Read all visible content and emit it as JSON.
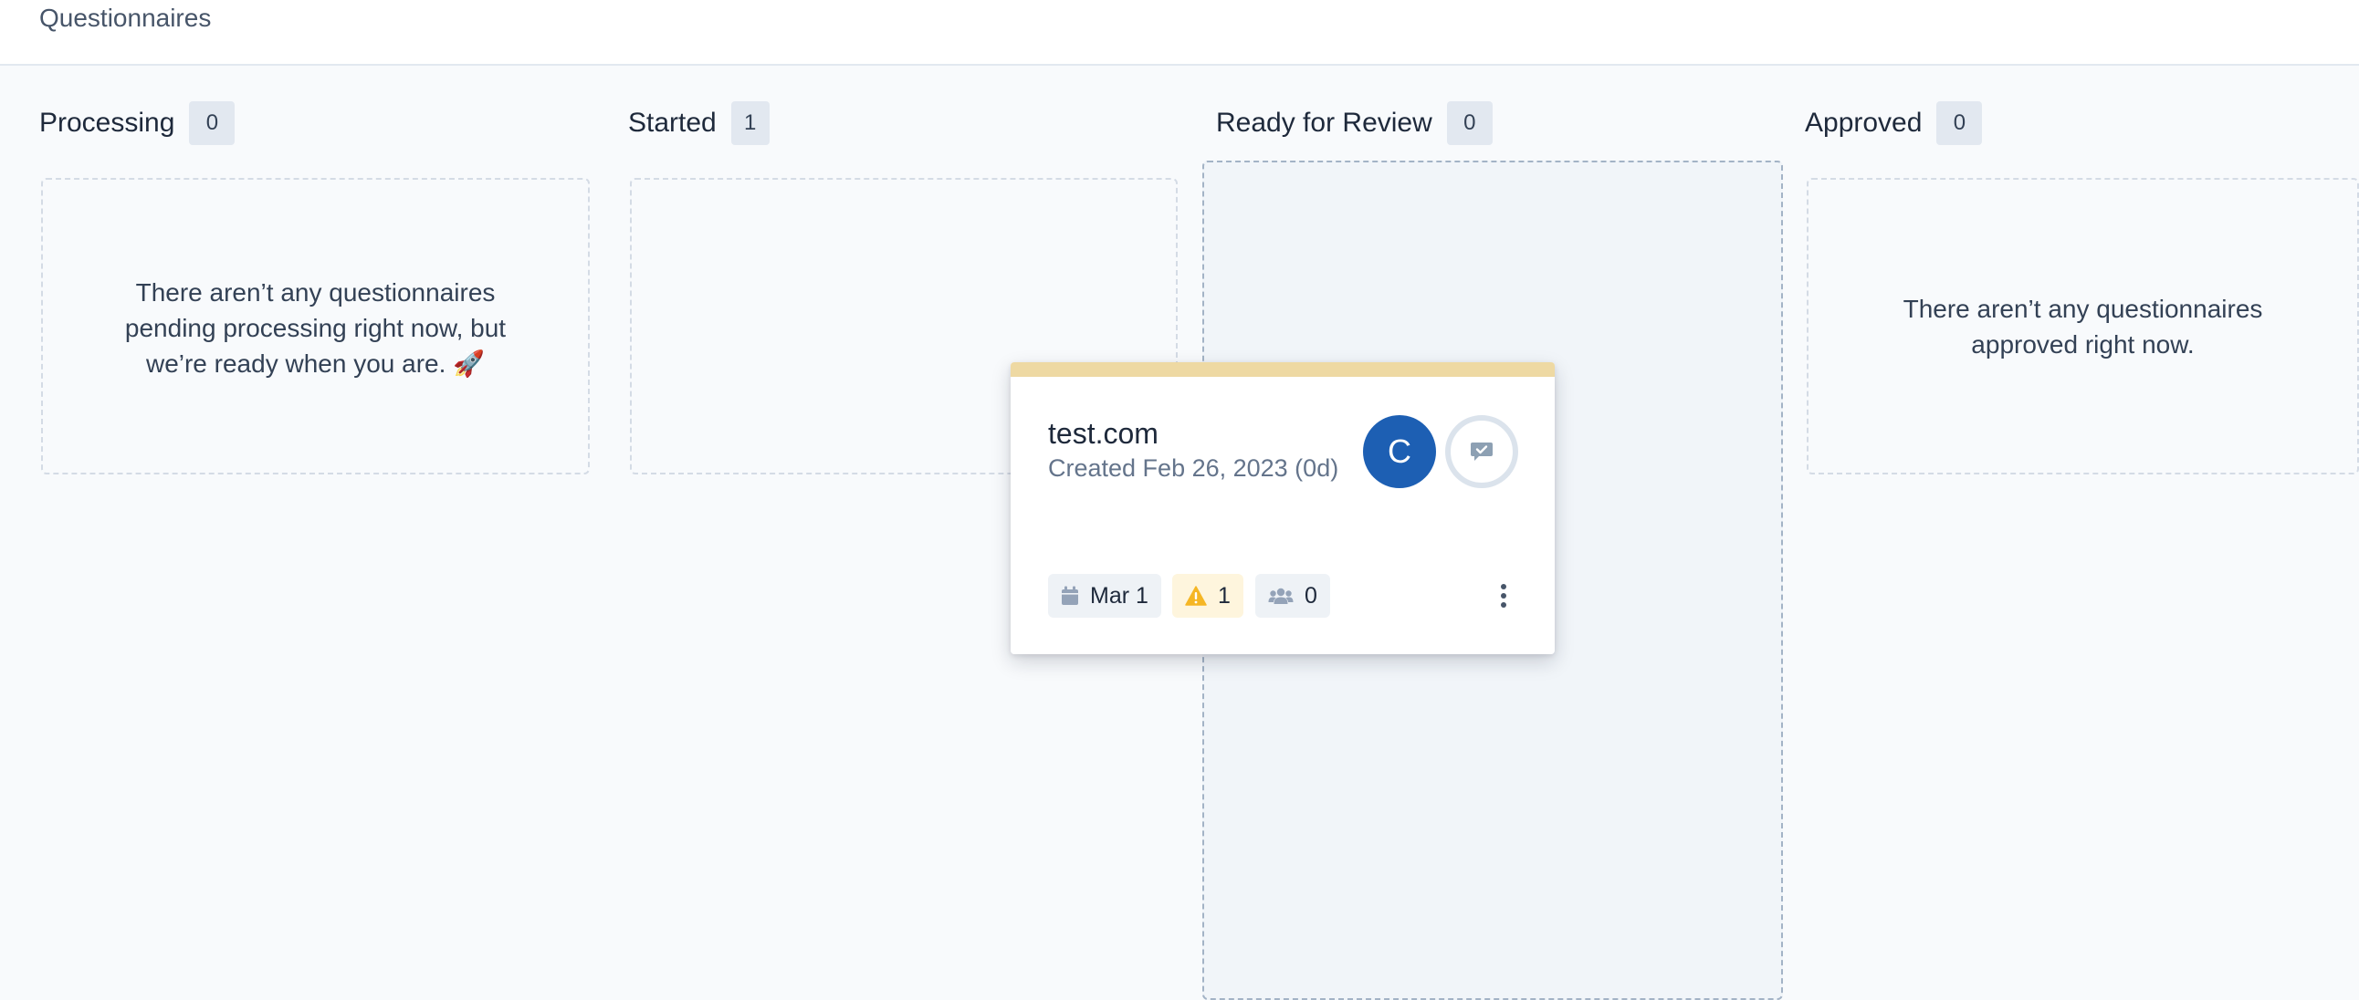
{
  "header": {
    "title": "Questionnaires"
  },
  "columns": [
    {
      "label": "Processing",
      "count": "0",
      "empty_message": [
        "There aren’t any questionnaires",
        "pending processing right now, but",
        "we’re ready when you are. 🚀"
      ]
    },
    {
      "label": "Started",
      "count": "1"
    },
    {
      "label": "Ready for Review",
      "count": "0"
    },
    {
      "label": "Approved",
      "count": "0",
      "empty_message": [
        "There aren’t any questionnaires",
        "approved right now."
      ]
    }
  ],
  "card": {
    "name": "test.com",
    "created": "Created Feb 26, 2023 (0d)",
    "avatar_initial": "C",
    "due_date": "Mar 1",
    "warnings": "1",
    "collaborators": "0",
    "icons": [
      "chat-check-icon",
      "calendar-icon",
      "warning-icon",
      "users-icon",
      "more-vertical-icon"
    ],
    "stripe_color": "#eed9a3",
    "avatar_color": "#1d5fb3"
  }
}
